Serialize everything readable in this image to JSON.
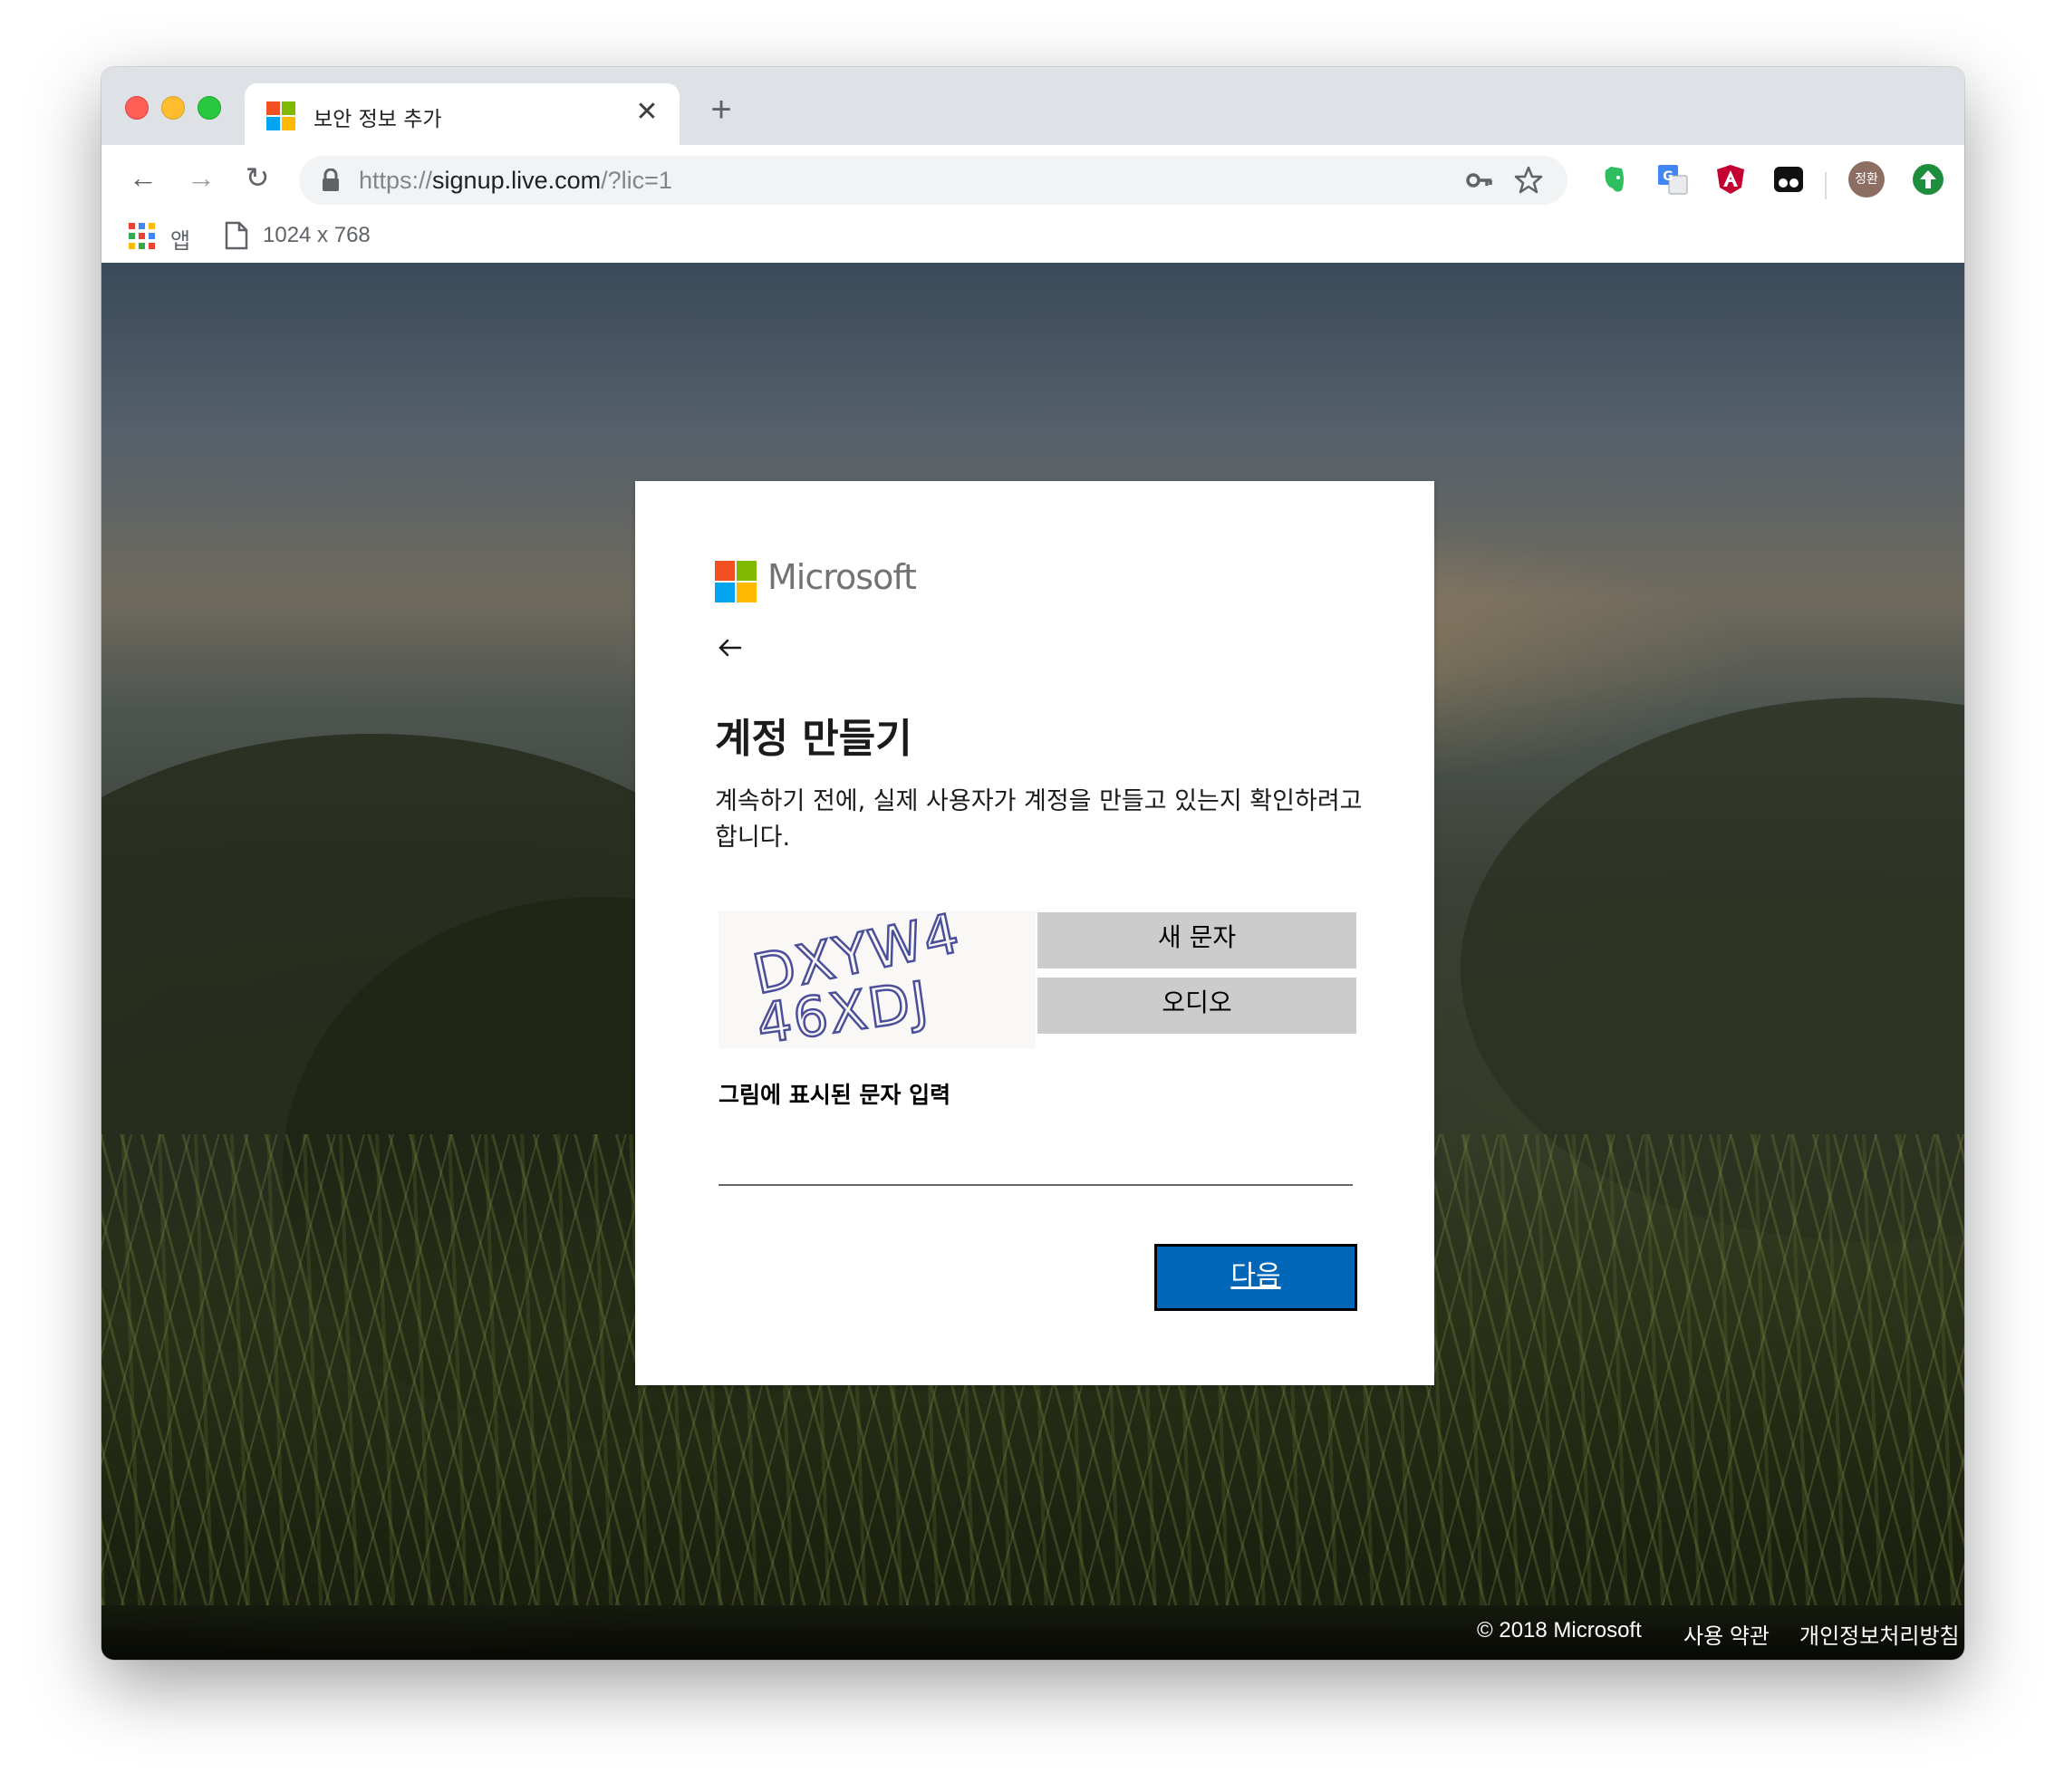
{
  "browser": {
    "tab": {
      "title": "보안 정보 추가",
      "close_glyph": "✕"
    },
    "new_tab_glyph": "+",
    "nav": {
      "back_glyph": "←",
      "forward_glyph": "→",
      "reload_glyph": "↻"
    },
    "url": {
      "scheme": "https://",
      "host": "signup.live.com",
      "path": "/?lic=1"
    },
    "profile_initials": "정환",
    "bookmarks": {
      "apps_label": "앱",
      "item_label": "1024 x 768"
    }
  },
  "dialog": {
    "brand": "Microsoft",
    "title": "계정 만들기",
    "description": "계속하기 전에, 실제 사용자가 계정을 만들고 있는지 확인하려고 합니다.",
    "captcha": {
      "line1": "DXYW4",
      "line2": "46XDJ",
      "new_text_label": "새 문자",
      "audio_label": "오디오",
      "input_label": "그림에 표시된 문자 입력",
      "input_value": ""
    },
    "next_label": "다음"
  },
  "footer": {
    "copyright": "© 2018 Microsoft",
    "terms": "사용 약관",
    "privacy": "개인정보처리방침"
  },
  "colors": {
    "accent": "#0067b8",
    "ms_red": "#f25022",
    "ms_green": "#7fba00",
    "ms_blue": "#00a4ef",
    "ms_yellow": "#ffb900"
  }
}
